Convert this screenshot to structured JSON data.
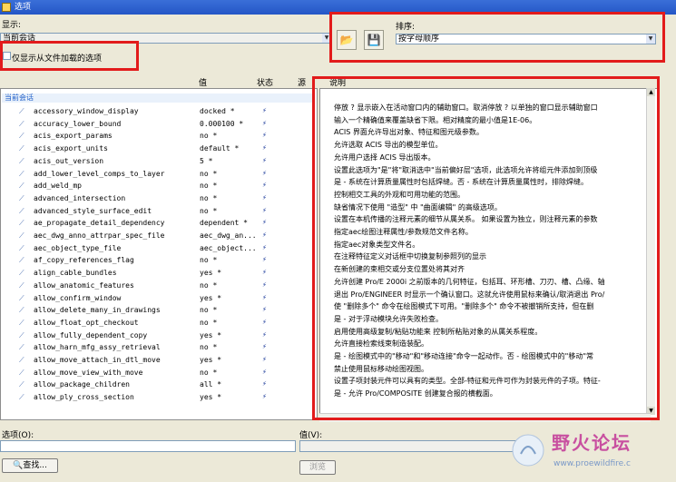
{
  "window": {
    "title": "选项"
  },
  "display": {
    "label": "显示:",
    "value": "当前会话"
  },
  "sort": {
    "label": "排序:",
    "value": "按字母顺序"
  },
  "toolbar": {
    "open_icon": "folder-open-icon",
    "save_icon": "save-icon"
  },
  "filter_checkbox": {
    "label": "仅显示从文件加载的选项",
    "checked": false
  },
  "columns": {
    "value": "值",
    "status": "状态",
    "source": "源",
    "description": "说明"
  },
  "group": "当前会话",
  "options": [
    {
      "name": "accessory_window_display",
      "value": "docked *"
    },
    {
      "name": "accuracy_lower_bound",
      "value": "0.000100 *"
    },
    {
      "name": "acis_export_params",
      "value": "no *"
    },
    {
      "name": "acis_export_units",
      "value": "default *"
    },
    {
      "name": "acis_out_version",
      "value": "5 *"
    },
    {
      "name": "add_lower_level_comps_to_layer",
      "value": "no *"
    },
    {
      "name": "add_weld_mp",
      "value": "no *"
    },
    {
      "name": "advanced_intersection",
      "value": "no *"
    },
    {
      "name": "advanced_style_surface_edit",
      "value": "no *"
    },
    {
      "name": "ae_propagate_detail_dependency",
      "value": "dependent *"
    },
    {
      "name": "aec_dwg_anno_attrpar_spec_file",
      "value": "aec_dwg_an..."
    },
    {
      "name": "aec_object_type_file",
      "value": "aec_object..."
    },
    {
      "name": "af_copy_references_flag",
      "value": "no *"
    },
    {
      "name": "align_cable_bundles",
      "value": "yes *"
    },
    {
      "name": "allow_anatomic_features",
      "value": "no *"
    },
    {
      "name": "allow_confirm_window",
      "value": "yes *"
    },
    {
      "name": "allow_delete_many_in_drawings",
      "value": "no *"
    },
    {
      "name": "allow_float_opt_checkout",
      "value": "no *"
    },
    {
      "name": "allow_fully_dependent_copy",
      "value": "yes *"
    },
    {
      "name": "allow_harn_mfg_assy_retrieval",
      "value": "no *"
    },
    {
      "name": "allow_move_attach_in_dtl_move",
      "value": "yes *"
    },
    {
      "name": "allow_move_view_with_move",
      "value": "no *"
    },
    {
      "name": "allow_package_children",
      "value": "all *"
    },
    {
      "name": "allow_ply_cross_section",
      "value": "yes *"
    }
  ],
  "descriptions": [
    "停放 ? 显示嵌入在活动窗口内的辅助窗口。取消停放 ? 以单独的窗口显示辅助窗口",
    "输入一个精确值来覆盖缺省下限。相对精度的最小值是1E-06。",
    "ACIS 界面允许导出对象、特征和图元级参数。",
    "允许选取 ACIS 导出的模型单位。",
    "允许用户选择 ACIS 导出版本。",
    "设置此选项为\"是\"将\"取消选中\"当前偏好层\"选项，此选项允许将组元件添加到顶级",
    "是 - 系统在计算质量属性时包括焊缝。否 - 系统在计算质量属性时，排除焊缝。",
    "控制相交工具的外观和可用功能的范围。",
    "缺省情况下使用 \"造型\" 中 \"曲面编辑\" 的高级选项。",
    "设置在本机传播的注释元素的细节从属关系。 如果设置为独立，则注释元素的参数",
    "指定aec绘图注释属性/参数规范文件名称。",
    "指定aec对象类型文件名。",
    "在注释特征定义对话框中切换复制参照列的显示",
    "在新创建的束相交或分支位置处将其对齐",
    "允许创建 Pro/E 2000i 之前版本的几何特征，包括耳、环形槽、刀刃、槽、凸缘、轴",
    "退出 Pro/ENGINEER 时显示一个确认窗口。这就允许使用鼠标来确认/取消退出 Pro/",
    "使 \"删除多个\" 命令在绘图模式下可用。\"删除多个\" 命令不被撤销所支持，但在删",
    "是 - 对于浮动模块允许失败检查。",
    "启用使用高级复制/粘贴功能来 控制所粘贴对象的从属关系程度。",
    "允许直接检索线束制造装配。",
    "是 - 绘图模式中的\"移动\"和\"移动连接\"命令一起动作。否 - 绘图模式中的\"移动\"常",
    "禁止使用鼠标移动绘图视图。",
    "设置子项封装元件可以具有的类型。全部-特征和元件可作为封装元件的子项。特征-",
    "是 - 允许 Pro/COMPOSITE 创建复合报的横截面。"
  ],
  "option_input": {
    "label": "选项(O):",
    "value": ""
  },
  "value_input": {
    "label": "值(V):"
  },
  "buttons": {
    "find": "查找...",
    "browse": "浏览"
  },
  "watermark": {
    "title": "野火论坛",
    "url": "www.proewildfire.c"
  },
  "annotation_color": "#e21b1b"
}
